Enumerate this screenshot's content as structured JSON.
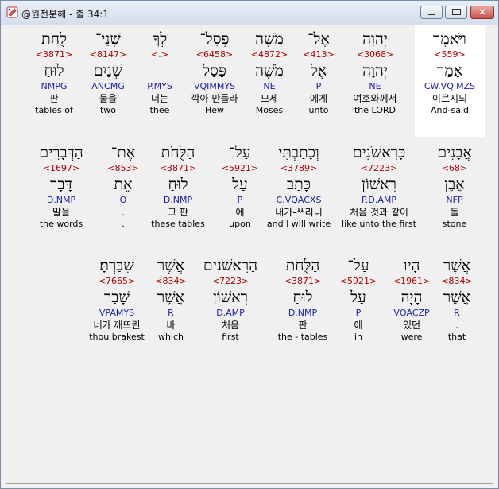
{
  "window": {
    "title": "@원전분해 - 출 34:1",
    "icon": "app-icon",
    "controls": [
      "minimize-icon",
      "maximize-icon",
      "close-icon"
    ]
  },
  "rows": [
    {
      "words": [
        {
          "hebrew": "וַיֹּאמֶר",
          "strong": "<559>",
          "lemma": "אָמַר",
          "parse": "CW.VQIMZS",
          "korean": "이르시되",
          "english": "And-said",
          "highlight": true
        },
        {
          "hebrew": "יְהוָה",
          "strong": "<3068>",
          "lemma": "יְהוָה",
          "parse": "NE",
          "korean": "여호와께서",
          "english": "the LORD"
        },
        {
          "hebrew": "אֶל־",
          "strong": "<413>",
          "lemma": "אֶל",
          "parse": "P",
          "korean": "에게",
          "english": "unto"
        },
        {
          "hebrew": "מֹשֶׁה",
          "strong": "<4872>",
          "lemma": "מֹשֶׁה",
          "parse": "NE",
          "korean": "모세",
          "english": "Moses"
        },
        {
          "hebrew": "פְּסָל־",
          "strong": "<6458>",
          "lemma": "פָּסַל",
          "parse": "VQIMMYS",
          "korean": "깍아 만들라",
          "english": "Hew"
        },
        {
          "hebrew": "לְךָ",
          "strong": "<.>",
          "lemma": "",
          "parse": "P.MYS",
          "korean": "너는",
          "english": "thee"
        },
        {
          "hebrew": "שְׁנֵי־",
          "strong": "<8147>",
          "lemma": "שְׁנַיִם",
          "parse": "ANCMG",
          "korean": "둘을",
          "english": "two"
        },
        {
          "hebrew": "לֻחֹת",
          "strong": "<3871>",
          "lemma": "לוּחַ",
          "parse": "NMPG",
          "korean": "판",
          "english": "tables of"
        }
      ]
    },
    {
      "words": [
        {
          "hebrew": "אֲבָנִים",
          "strong": "<68>",
          "lemma": "אֶבֶן",
          "parse": "NFP",
          "korean": "돌",
          "english": "stone"
        },
        {
          "hebrew": "כָּרִאשֹׁנִים",
          "strong": "<7223>",
          "lemma": "רִאשׁוֹן",
          "parse": "P.D.AMP",
          "korean": "처음 것과 같이",
          "english": "like unto the first"
        },
        {
          "hebrew": "וְכָתַבְתִּי",
          "strong": "<3789>",
          "lemma": "כָּתַב",
          "parse": "C.VQACXS",
          "korean": "내가-쓰리니",
          "english": "and I will write"
        },
        {
          "hebrew": "עַל־",
          "strong": "<5921>",
          "lemma": "עַל",
          "parse": "P",
          "korean": "에",
          "english": "upon"
        },
        {
          "hebrew": "הַלֻּחֹת",
          "strong": "<3871>",
          "lemma": "לוּחַ",
          "parse": "D.NMP",
          "korean": "그 판",
          "english": "these tables"
        },
        {
          "hebrew": "אֶת־",
          "strong": "<853>",
          "lemma": "אֵת",
          "parse": "O",
          "korean": ".",
          "english": "."
        },
        {
          "hebrew": "הַדְּבָרִים",
          "strong": "<1697>",
          "lemma": "דָּבָר",
          "parse": "D.NMP",
          "korean": "말을",
          "english": "the words"
        }
      ]
    },
    {
      "words": [
        {
          "hebrew": "אֲשֶׁר",
          "strong": "<834>",
          "lemma": "אֲשֶׁר",
          "parse": "R",
          "korean": ".",
          "english": "that"
        },
        {
          "hebrew": "הָיוּ",
          "strong": "<1961>",
          "lemma": "הָיָה",
          "parse": "VQACZP",
          "korean": "있던",
          "english": "were"
        },
        {
          "hebrew": "עַל־",
          "strong": "<5921>",
          "lemma": "עַל",
          "parse": "P",
          "korean": "에",
          "english": "in"
        },
        {
          "hebrew": "הַלֻּחֹת",
          "strong": "<3871>",
          "lemma": "לוּחַ",
          "parse": "D.NMP",
          "korean": "판",
          "english": "the - tables"
        },
        {
          "hebrew": "הָרִאשֹׁנִים",
          "strong": "<7223>",
          "lemma": "רִאשׁוֹן",
          "parse": "D.AMP",
          "korean": "처음",
          "english": "first"
        },
        {
          "hebrew": "אֲשֶׁר",
          "strong": "<834>",
          "lemma": "אֲשֶׁר",
          "parse": "R",
          "korean": "바",
          "english": "which"
        },
        {
          "hebrew": "שִׁבַּרְתָּ׃",
          "strong": "<7665>",
          "lemma": "שָׁבַר",
          "parse": "VPAMYS",
          "korean": "네가 깨뜨린",
          "english": "thou brakest"
        }
      ]
    }
  ]
}
